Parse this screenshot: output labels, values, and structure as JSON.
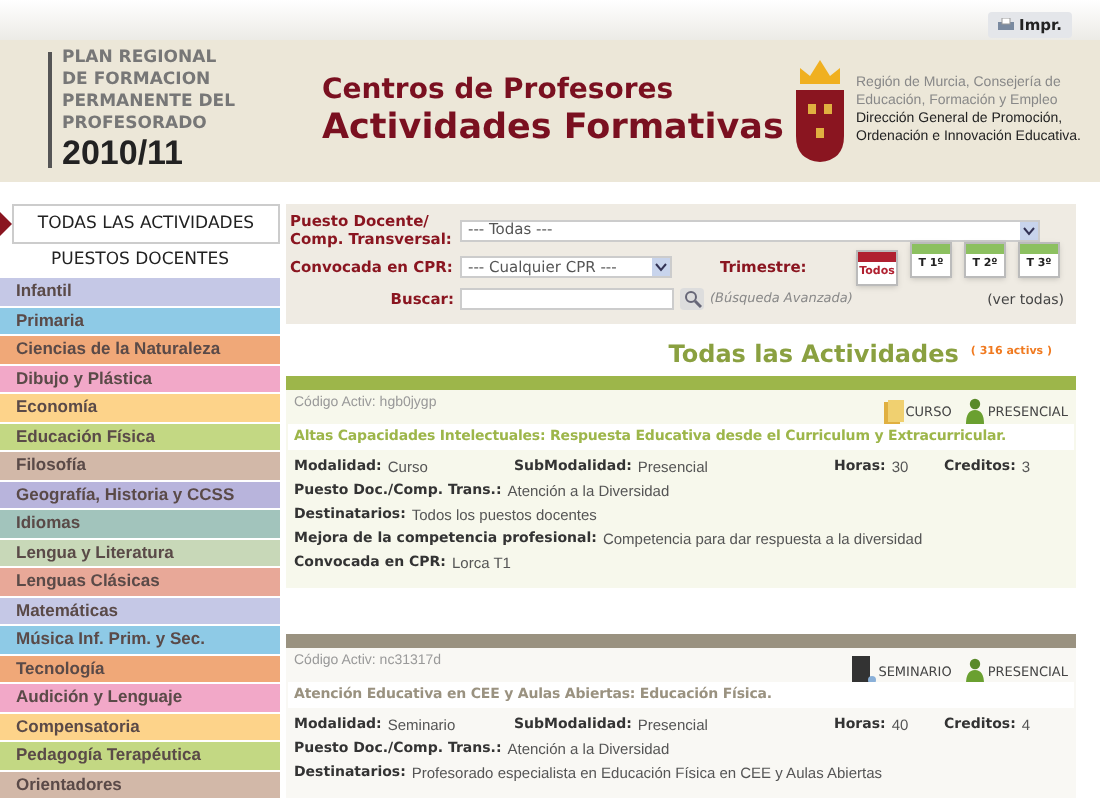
{
  "toolbar": {
    "print_button": "Impr."
  },
  "header": {
    "plan_lines": [
      "PLAN REGIONAL",
      "DE FORMACION",
      "PERMANENTE DEL",
      "PROFESORADO"
    ],
    "year": "2010/11",
    "title_line_1": "Centros de Profesores",
    "title_line_2": "Actividades Formativas",
    "org_line_1": "Región de Murcia, Consejería de",
    "org_line_2": "Educación, Formación y Empleo",
    "org_line_3": "Dirección General de Promoción,",
    "org_line_4": "Ordenación e Innovación Educativa."
  },
  "sidebar": {
    "all_item": {
      "label": "TODAS LAS ACTIVIDADES",
      "selected": true
    },
    "heading": "PUESTOS DOCENTES",
    "items": [
      {
        "label": "Infantil",
        "color": "#c5c8e6"
      },
      {
        "label": "Primaria",
        "color": "#8ecae6"
      },
      {
        "label": "Ciencias de la Naturaleza",
        "color": "#f0a878"
      },
      {
        "label": "Dibujo y Plástica",
        "color": "#f2a8c8"
      },
      {
        "label": "Economía",
        "color": "#fdd38a"
      },
      {
        "label": "Educación Física",
        "color": "#c3d883"
      },
      {
        "label": "Filosofía",
        "color": "#d2b8a8"
      },
      {
        "label": "Geografía, Historia y CCSS",
        "color": "#b8b4dc"
      },
      {
        "label": "Idiomas",
        "color": "#a2c4bc"
      },
      {
        "label": "Lengua y Literatura",
        "color": "#c8d8b8"
      },
      {
        "label": "Lenguas Clásicas",
        "color": "#e8a898"
      },
      {
        "label": "Matemáticas",
        "color": "#c5c8e6"
      },
      {
        "label": "Música Inf. Prim. y Sec.",
        "color": "#8ecae6"
      },
      {
        "label": "Tecnología",
        "color": "#f0a878"
      },
      {
        "label": "Audición y Lenguaje",
        "color": "#f2a8c8"
      },
      {
        "label": "Compensatoria",
        "color": "#fdd38a"
      },
      {
        "label": "Pedagogía Terapéutica",
        "color": "#c3d883"
      },
      {
        "label": "Orientadores",
        "color": "#d2b8a8"
      }
    ]
  },
  "filters": {
    "puesto_label_1": "Puesto Docente/",
    "puesto_label_2": "Comp. Transversal:",
    "puesto_value": "--- Todas ---",
    "cpr_label": "Convocada en CPR:",
    "cpr_value": "--- Cualquier CPR ---",
    "trimestre_label": "Trimestre:",
    "trimestres": [
      {
        "label": "Todos",
        "selected": true
      },
      {
        "label": "T 1º",
        "selected": false
      },
      {
        "label": "T 2º",
        "selected": false
      },
      {
        "label": "T 3º",
        "selected": false
      }
    ],
    "buscar_label": "Buscar:",
    "advanced_link": "(Búsqueda Avanzada)",
    "see_all_link": "(ver todas)"
  },
  "results": {
    "title": "Todas las Actividades",
    "count": "( 316 activs )"
  },
  "activities": [
    {
      "code": "Código Activ: hgb0jygp",
      "color": "#9db64a",
      "tags": [
        {
          "label": "CURSO",
          "kind": "folder"
        },
        {
          "label": "PRESENCIAL",
          "kind": "person"
        }
      ],
      "title": "Altas Capacidades Intelectuales: Respuesta Educativa desde el Curriculum y Extracurricular.",
      "rows": [
        [
          {
            "label": "Modalidad:",
            "value": "Curso"
          },
          {
            "label": "SubModalidad:",
            "value": "Presencial"
          },
          {
            "label": "Horas:",
            "value": "30"
          },
          {
            "label": "Creditos:",
            "value": "3"
          }
        ],
        [
          {
            "label": "Puesto Doc./Comp. Trans.:",
            "value": "Atención a la Diversidad"
          }
        ],
        [
          {
            "label": "Destinatarios:",
            "value": "Todos los puestos docentes"
          }
        ],
        [
          {
            "label": "Mejora de la competencia profesional:",
            "value": "Competencia para dar respuesta a la diversidad"
          }
        ],
        [
          {
            "label": "Convocada en CPR:",
            "value": "Lorca T1"
          }
        ]
      ]
    },
    {
      "code": "Código Activ: nc31317d",
      "color": "#9a9280",
      "tags": [
        {
          "label": "SEMINARIO",
          "kind": "book"
        },
        {
          "label": "PRESENCIAL",
          "kind": "person"
        }
      ],
      "title": "Atención Educativa en CEE y Aulas Abiertas: Educación Física.",
      "rows": [
        [
          {
            "label": "Modalidad:",
            "value": "Seminario"
          },
          {
            "label": "SubModalidad:",
            "value": "Presencial"
          },
          {
            "label": "Horas:",
            "value": "40"
          },
          {
            "label": "Creditos:",
            "value": "4"
          }
        ],
        [
          {
            "label": "Puesto Doc./Comp. Trans.:",
            "value": "Atención a la Diversidad"
          }
        ],
        [
          {
            "label": "Destinatarios:",
            "value": "Profesorado especialista en Educación Física en CEE y Aulas Abiertas"
          }
        ]
      ]
    }
  ]
}
